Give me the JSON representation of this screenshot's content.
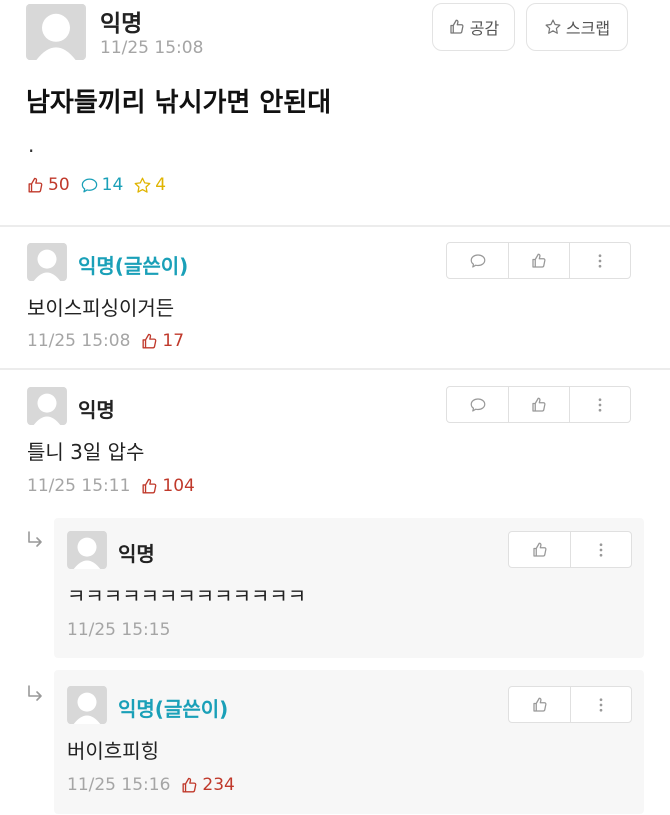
{
  "post": {
    "author": "익명",
    "time": "11/25 15:08",
    "like_button_label": "공감",
    "scrap_button_label": "스크랩",
    "title": "남자들끼리 낚시가면 안된대",
    "body": ".",
    "stats": {
      "likes": "50",
      "comments": "14",
      "scraps": "4"
    }
  },
  "comments": [
    {
      "author": "익명(글쓴이)",
      "text": "보이스피싱이거든",
      "time": "11/25 15:08",
      "likes": "17"
    },
    {
      "author": "익명",
      "text": "틀니 3일 압수",
      "time": "11/25 15:11",
      "likes": "104"
    }
  ],
  "replies": [
    {
      "author": "익명",
      "text": "ㅋㅋㅋㅋㅋㅋㅋㅋㅋㅋㅋㅋㅋ",
      "time": "11/25 15:15"
    },
    {
      "author": "익명(글쓴이)",
      "text": "버이흐피힝",
      "time": "11/25 15:16",
      "likes": "234"
    }
  ],
  "colors": {
    "like": "#c0392b",
    "comment": "#1aa0b8",
    "scrap": "#e0b400",
    "op_author": "#1aa0b8",
    "meta_gray": "#a5a5a5"
  },
  "icons": [
    "avatar-icon",
    "thumbs-up-icon",
    "star-icon",
    "speech-bubble-icon",
    "more-vertical-icon",
    "reply-arrow-icon"
  ]
}
